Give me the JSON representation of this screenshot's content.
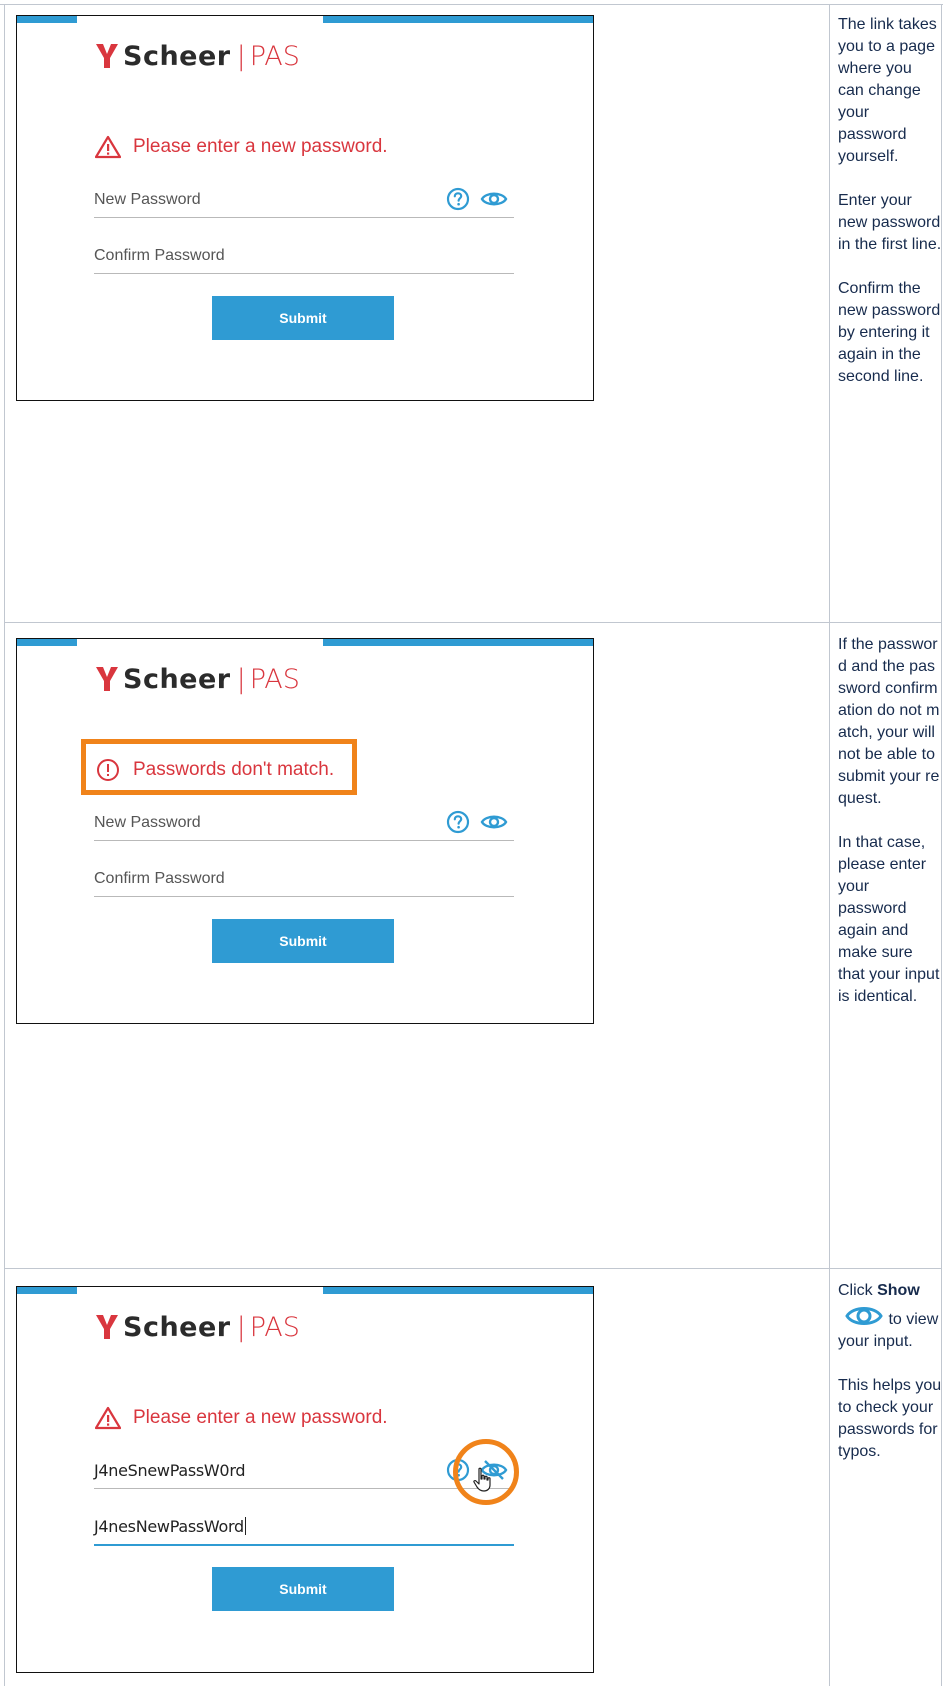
{
  "colors": {
    "accent": "#2f9bd3",
    "error": "#d9363e",
    "highlight": "#f0831a"
  },
  "shots": [
    {
      "logo_brand": "Scheer",
      "logo_sep": "|",
      "logo_product": "PAS",
      "message": "Please enter a new password.",
      "message_icon": "warning-triangle-icon",
      "new_password": {
        "label": "New Password"
      },
      "confirm_password": {
        "label": "Confirm Password"
      },
      "submit_label": "Submit"
    },
    {
      "logo_brand": "Scheer",
      "logo_sep": "|",
      "logo_product": "PAS",
      "message": "Passwords don't match.",
      "message_icon": "exclamation-circle-icon",
      "new_password": {
        "label": "New Password"
      },
      "confirm_password": {
        "label": "Confirm Password"
      },
      "submit_label": "Submit"
    },
    {
      "logo_brand": "Scheer",
      "logo_sep": "|",
      "logo_product": "PAS",
      "message": "Please enter a new password.",
      "message_icon": "warning-triangle-icon",
      "new_password": {
        "value": "J4neSnewPassW0rd"
      },
      "confirm_password": {
        "value": "J4nesNewPassWord"
      },
      "submit_label": "Submit"
    }
  ],
  "notes": [
    {
      "p1": "The link takes you to a page where you can change your password yourself.",
      "p2": "Enter your new password in the first line.",
      "p3": "Confirm the new password by entering it again in the second line."
    },
    {
      "p1": "If the password and the password confirmation do not match, your will not be able to submit your request.",
      "p2": "In that case, please enter your password again and make sure that your input is identical."
    },
    {
      "p1_pre": "Click ",
      "p1_bold": "Show",
      "p1_post": "to view your input.",
      "p2": "This helps you to check your passwords for typos."
    }
  ]
}
